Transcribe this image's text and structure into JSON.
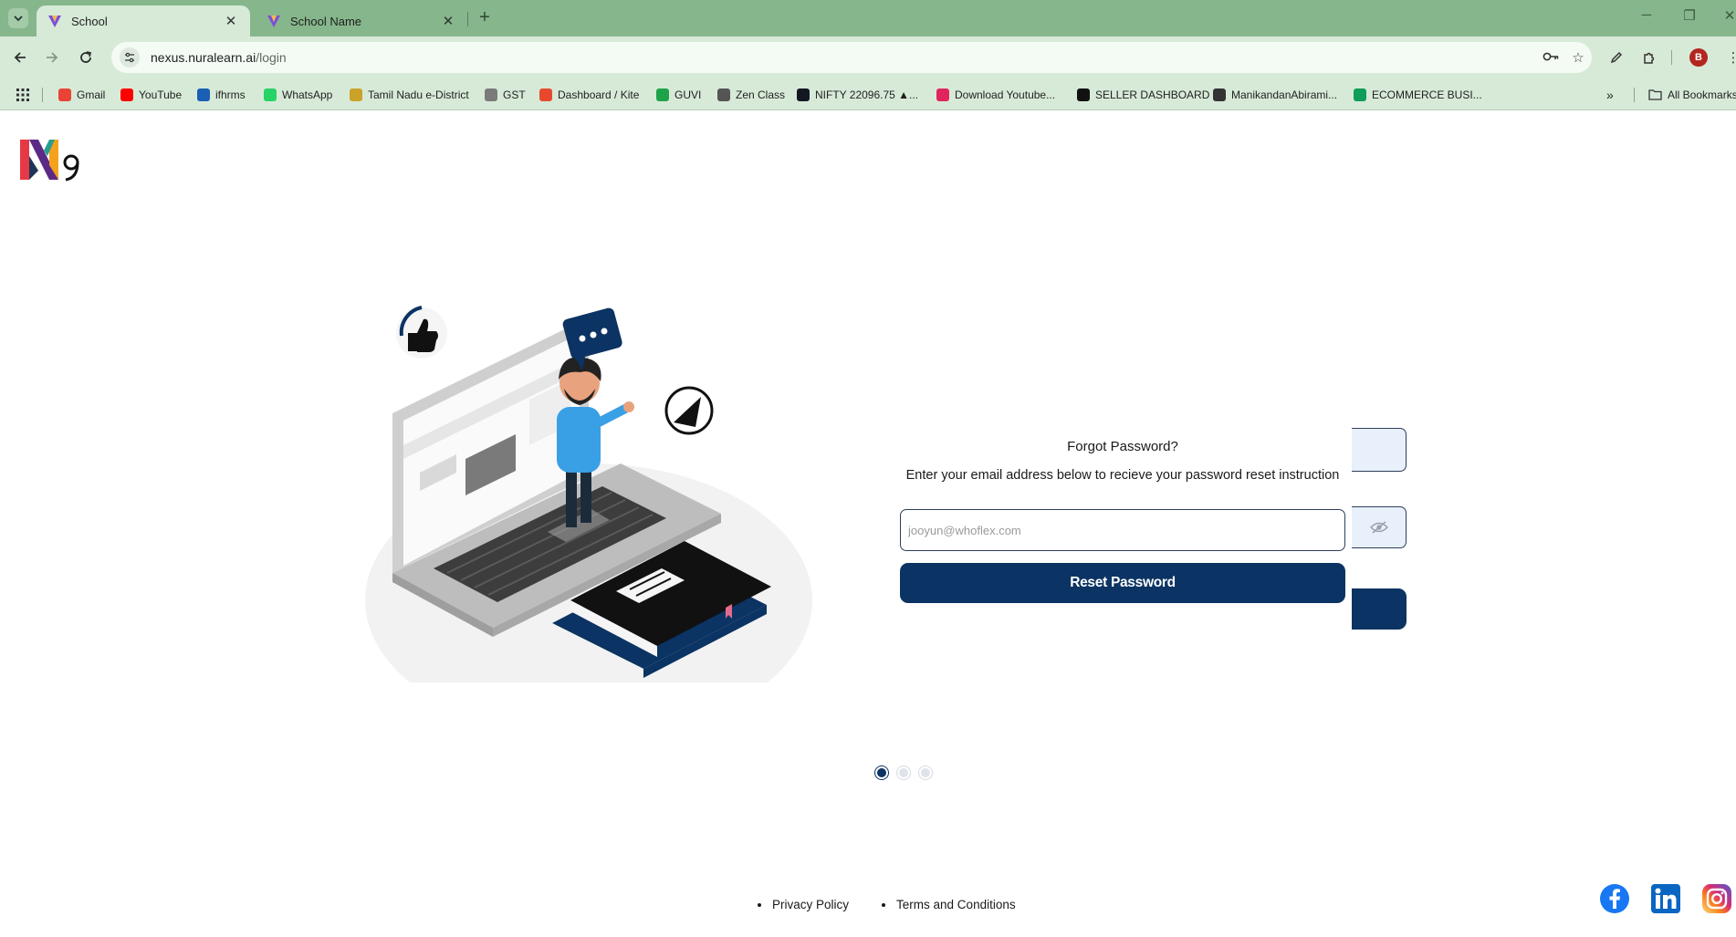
{
  "browser": {
    "tabs": [
      {
        "title": "School",
        "active": true
      },
      {
        "title": "School Name",
        "active": false
      }
    ],
    "address": {
      "host": "nexus.nuralearn.ai",
      "path": "/login"
    },
    "bookmarks": [
      {
        "label": "Gmail",
        "icon": "gmail-icon",
        "color": "#ea4335"
      },
      {
        "label": "YouTube",
        "icon": "youtube-icon",
        "color": "#ff0000"
      },
      {
        "label": "ifhrms",
        "icon": "ifhrms-icon",
        "color": "#1a5fb4"
      },
      {
        "label": "WhatsApp",
        "icon": "whatsapp-icon",
        "color": "#25d366"
      },
      {
        "label": "Tamil Nadu e-District",
        "icon": "emblem-icon",
        "color": "#c9a227"
      },
      {
        "label": "GST",
        "icon": "emblem-icon",
        "color": "#7a7a7a"
      },
      {
        "label": "Dashboard / Kite",
        "icon": "kite-icon",
        "color": "#e8492e"
      },
      {
        "label": "GUVI",
        "icon": "guvi-icon",
        "color": "#1fa34a"
      },
      {
        "label": "Zen Class",
        "icon": "zen-icon",
        "color": "#555555"
      },
      {
        "label": "NIFTY 22096.75 ▲...",
        "icon": "tradingview-icon",
        "color": "#131722"
      },
      {
        "label": "Download Youtube...",
        "icon": "download-icon",
        "color": "#e0245e"
      },
      {
        "label": "SELLER DASHBOARD",
        "icon": "amazon-icon",
        "color": "#111111"
      },
      {
        "label": "ManikandanAbirami...",
        "icon": "github-icon",
        "color": "#333333"
      },
      {
        "label": "ECOMMERCE BUSI...",
        "icon": "sheets-icon",
        "color": "#0f9d58"
      }
    ],
    "all_bookmarks": "All Bookmarks",
    "profile_initial": "B"
  },
  "page": {
    "forgot": {
      "title": "Forgot Password?",
      "description": "Enter your email address below to recieve your password reset instruction",
      "email_placeholder": "jooyun@whoflex.com",
      "button_label": "Reset Password"
    },
    "carousel": {
      "count": 3,
      "active_index": 0
    },
    "footer": {
      "privacy": "Privacy Policy",
      "terms": "Terms and Conditions"
    },
    "social": [
      "facebook-icon",
      "linkedin-icon",
      "instagram-icon"
    ],
    "colors": {
      "primary": "#0b3363",
      "chrome": "#86b68b",
      "toolbar": "#d7ead8"
    }
  }
}
